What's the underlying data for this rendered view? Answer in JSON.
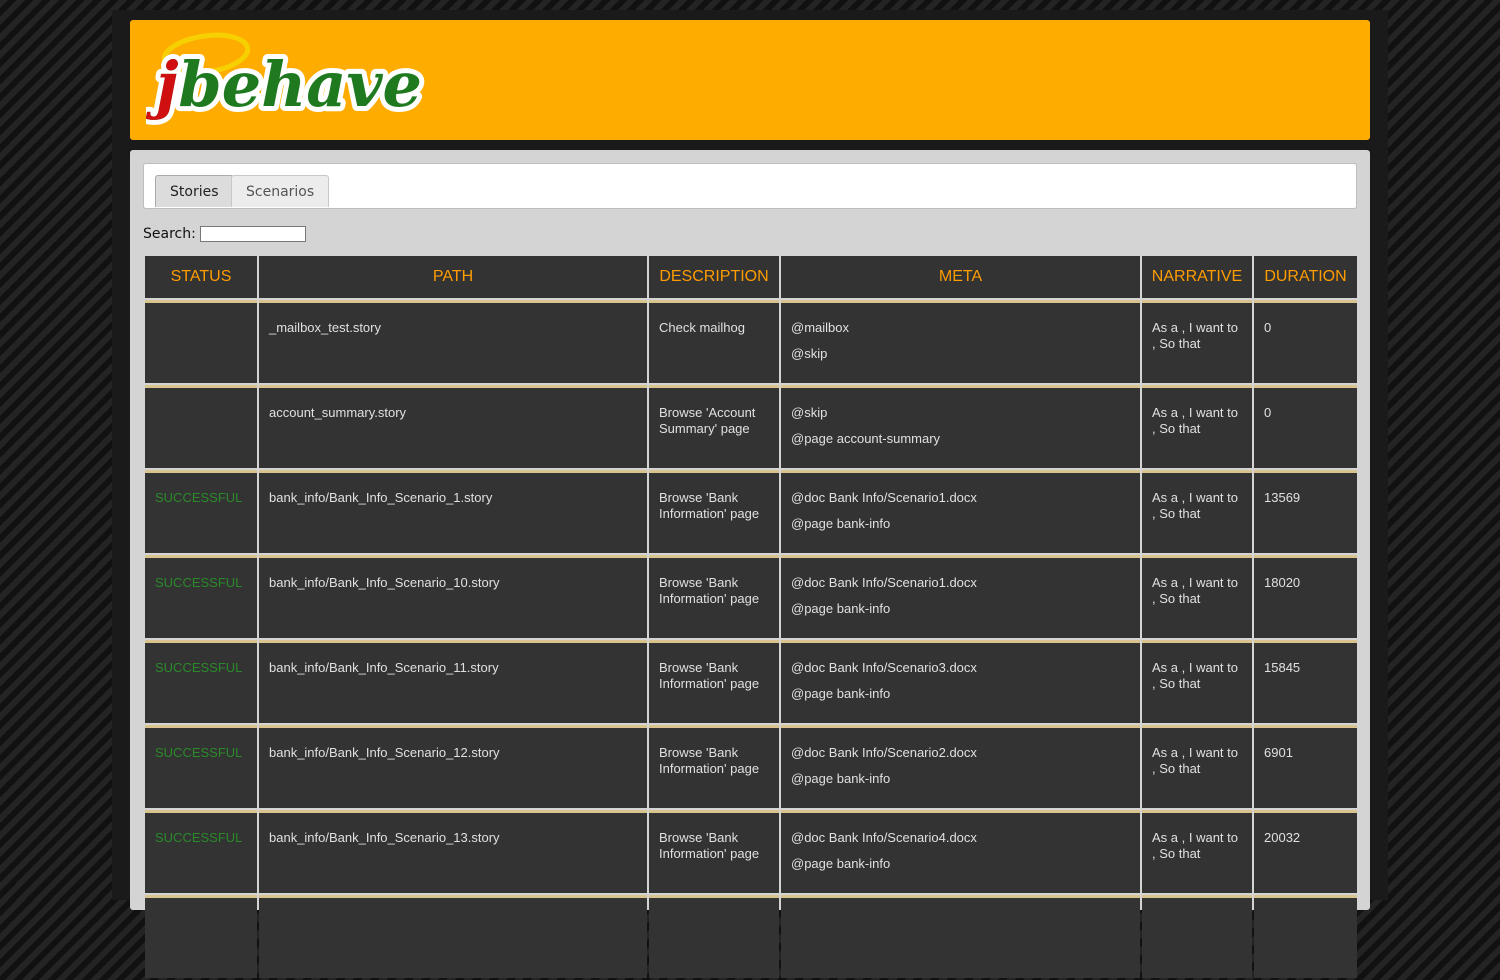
{
  "brand": {
    "logo_text": "jbehave",
    "header_color": "#ffac00"
  },
  "tabs": [
    {
      "label": "Stories",
      "active": true
    },
    {
      "label": "Scenarios",
      "active": false
    }
  ],
  "search": {
    "label": "Search:",
    "value": ""
  },
  "table": {
    "columns": [
      "STATUS",
      "PATH",
      "DESCRIPTION",
      "META",
      "NARRATIVE",
      "DURATION"
    ],
    "rows": [
      {
        "status": "",
        "path": "_mailbox_test.story",
        "description": "Check mailhog",
        "meta": [
          "@mailbox",
          "@skip"
        ],
        "narrative": "As a , I want to , So that",
        "duration": "0"
      },
      {
        "status": "",
        "path": "account_summary.story",
        "description": "Browse 'Account Summary' page",
        "meta": [
          "@skip",
          "@page account-summary"
        ],
        "narrative": "As a , I want to , So that",
        "duration": "0"
      },
      {
        "status": "SUCCESSFUL",
        "path": "bank_info/Bank_Info_Scenario_1.story",
        "description": "Browse 'Bank Information' page",
        "meta": [
          "@doc Bank Info/Scenario1.docx",
          "@page bank-info"
        ],
        "narrative": "As a , I want to , So that",
        "duration": "13569"
      },
      {
        "status": "SUCCESSFUL",
        "path": "bank_info/Bank_Info_Scenario_10.story",
        "description": "Browse 'Bank Information' page",
        "meta": [
          "@doc Bank Info/Scenario1.docx",
          "@page bank-info"
        ],
        "narrative": "As a , I want to , So that",
        "duration": "18020"
      },
      {
        "status": "SUCCESSFUL",
        "path": "bank_info/Bank_Info_Scenario_11.story",
        "description": "Browse 'Bank Information' page",
        "meta": [
          "@doc Bank Info/Scenario3.docx",
          "@page bank-info"
        ],
        "narrative": "As a , I want to , So that",
        "duration": "15845"
      },
      {
        "status": "SUCCESSFUL",
        "path": "bank_info/Bank_Info_Scenario_12.story",
        "description": "Browse 'Bank Information' page",
        "meta": [
          "@doc Bank Info/Scenario2.docx",
          "@page bank-info"
        ],
        "narrative": "As a , I want to , So that",
        "duration": "6901"
      },
      {
        "status": "SUCCESSFUL",
        "path": "bank_info/Bank_Info_Scenario_13.story",
        "description": "Browse 'Bank Information' page",
        "meta": [
          "@doc Bank Info/Scenario4.docx",
          "@page bank-info"
        ],
        "narrative": "As a , I want to , So that",
        "duration": "20032"
      }
    ]
  }
}
